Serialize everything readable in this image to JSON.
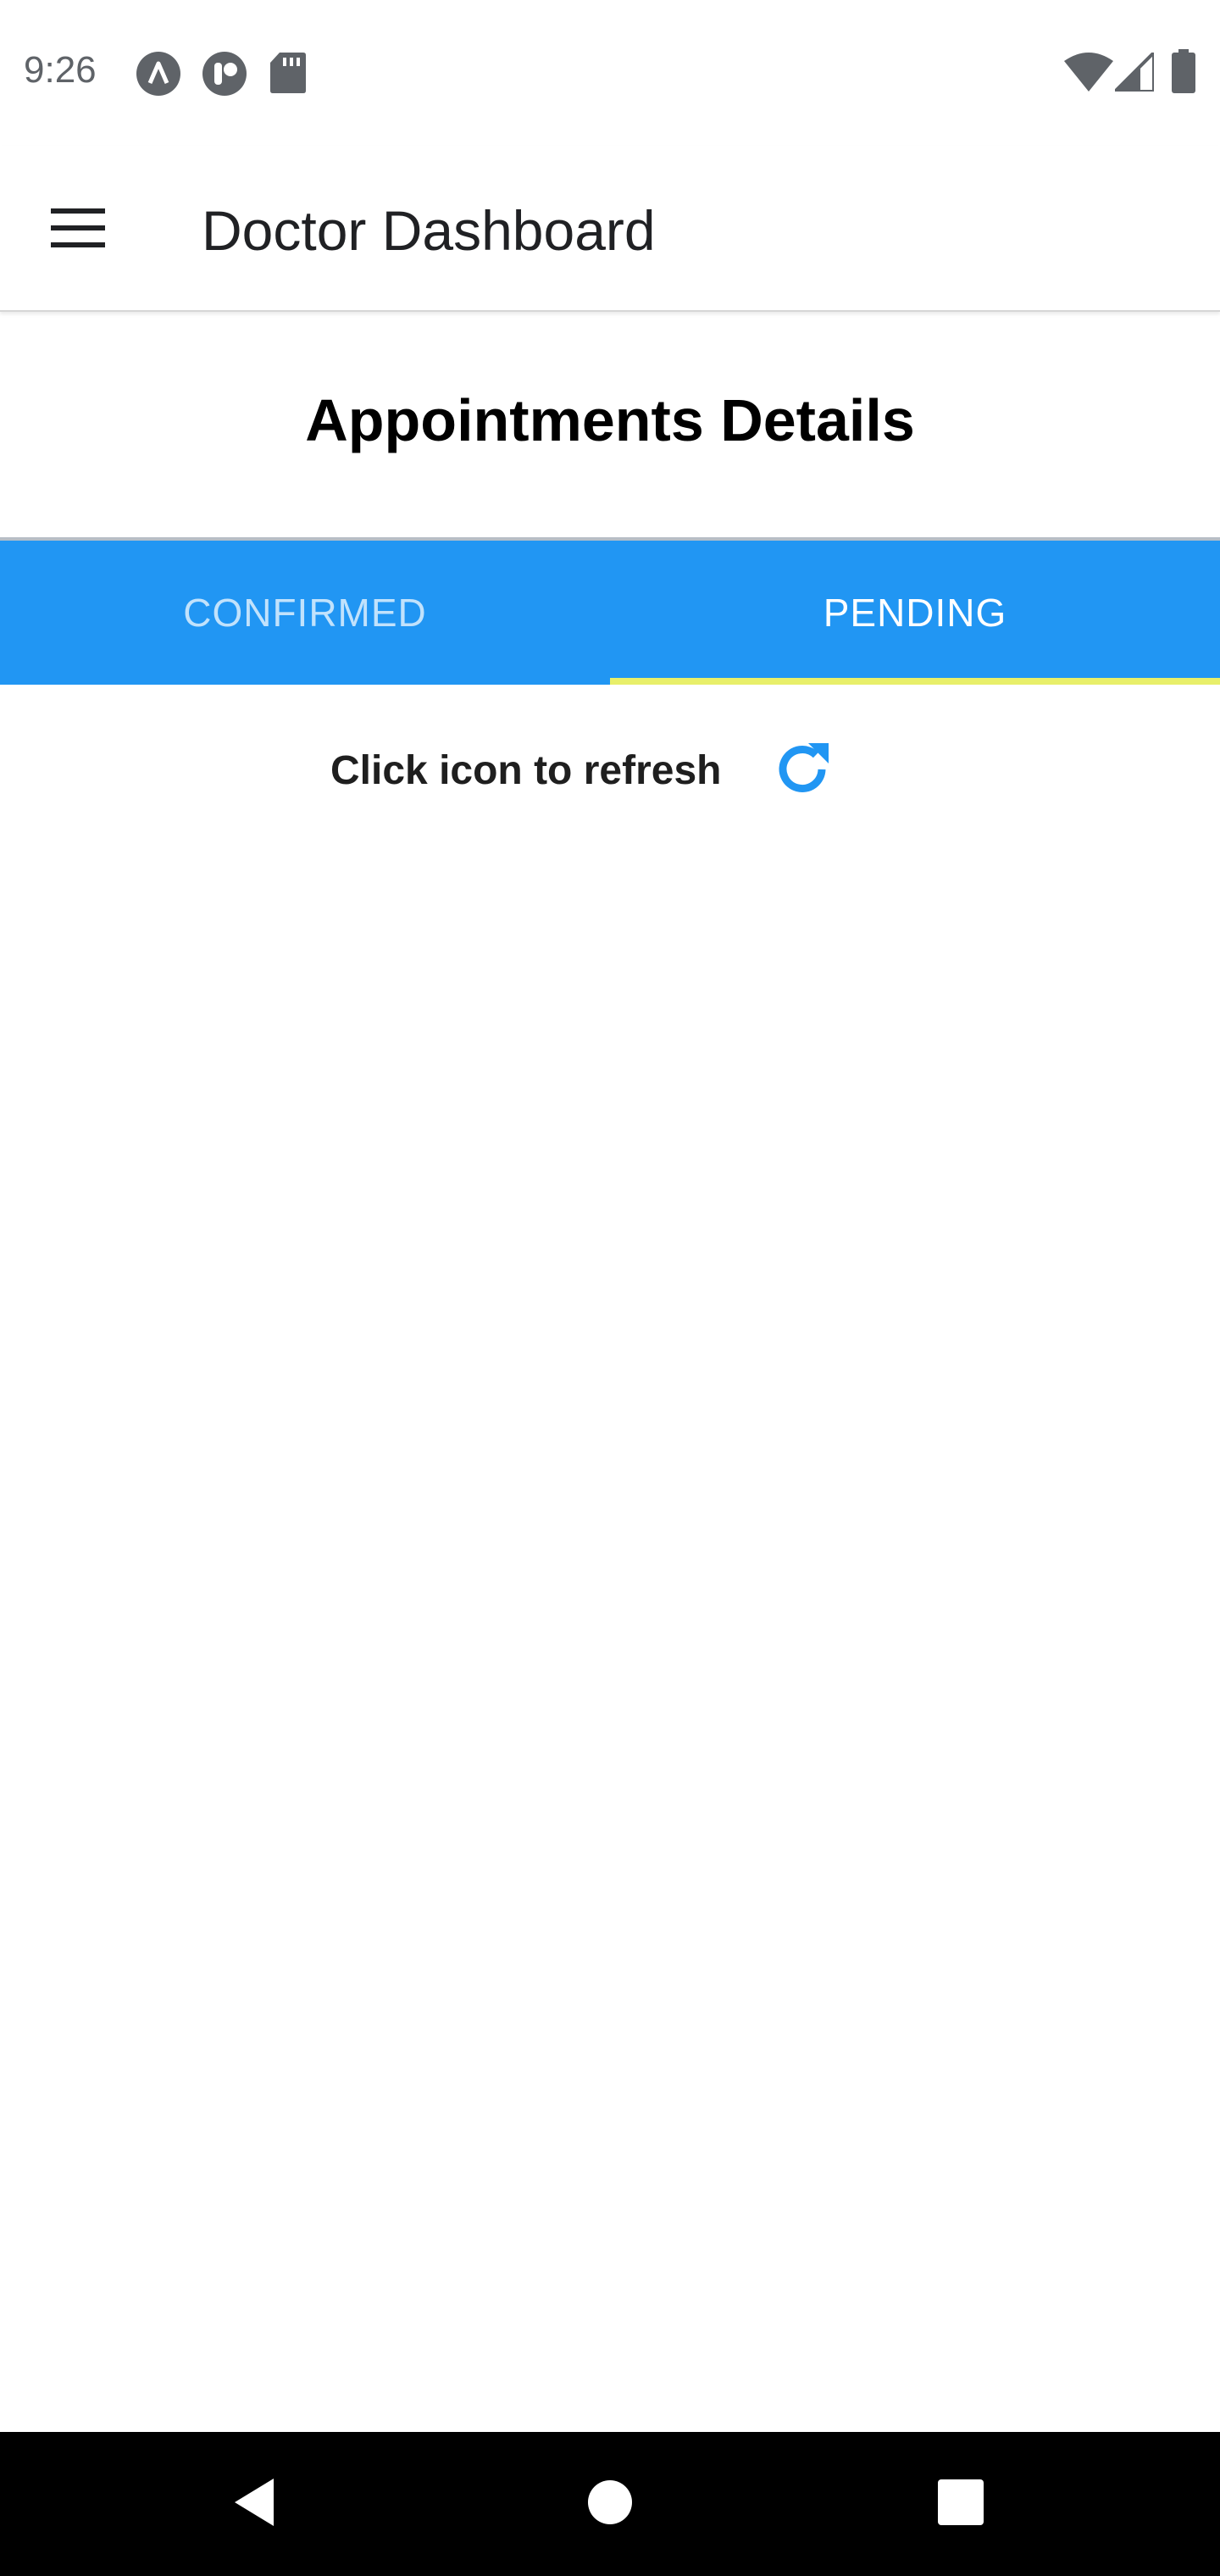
{
  "status_bar": {
    "time": "9:26",
    "left_icons": [
      "app-badge-icon",
      "app-badge-icon",
      "sd-card-icon"
    ],
    "right_icons": [
      "wifi-icon",
      "cell-signal-icon",
      "battery-icon"
    ]
  },
  "app_bar": {
    "menu_icon": "hamburger-menu-icon",
    "title": "Doctor Dashboard"
  },
  "section": {
    "title": "Appointments Details"
  },
  "tabs": [
    {
      "label": "CONFIRMED",
      "active": false
    },
    {
      "label": "PENDING",
      "active": true
    }
  ],
  "refresh": {
    "text": "Click icon to refresh",
    "icon": "refresh-icon"
  },
  "colors": {
    "tab_bar": "#2196f3",
    "tab_indicator": "#e8ef6a",
    "refresh_icon": "#2196f3"
  },
  "nav_bar": {
    "buttons": [
      "back-icon",
      "home-icon",
      "recents-icon"
    ]
  }
}
